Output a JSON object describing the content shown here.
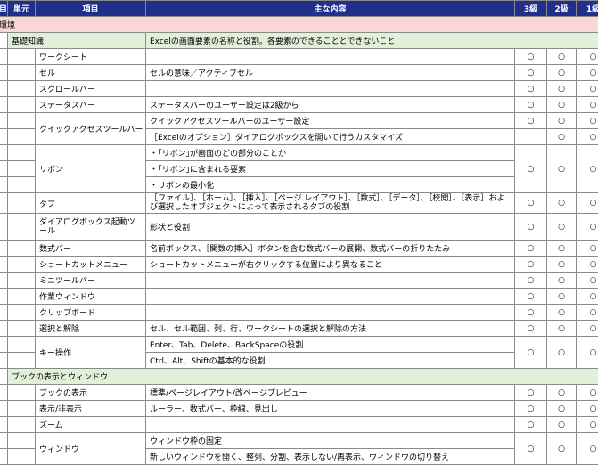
{
  "header": {
    "col0": "目",
    "unit": "単元",
    "item": "項目",
    "content": "主な内容",
    "g3": "3級",
    "g2": "2級",
    "g1": "1級"
  },
  "section": "環境",
  "groups": [
    {
      "title": "基礎知識",
      "title_content": "Excelの画面要素の名称と役割。各要素のできることとできないこと",
      "rows": [
        {
          "item": "ワークシート",
          "contents": [
            ""
          ],
          "g3": "○",
          "g2": "○",
          "g1": "○"
        },
        {
          "item": "セル",
          "contents": [
            "セルの意味／アクティブセル"
          ],
          "g3": "○",
          "g2": "○",
          "g1": "○"
        },
        {
          "item": "スクロールバー",
          "contents": [
            ""
          ],
          "g3": "○",
          "g2": "○",
          "g1": "○"
        },
        {
          "item": "ステータスバー",
          "contents": [
            "ステータスバーのユーザー設定は2級から"
          ],
          "g3": "○",
          "g2": "○",
          "g1": "○"
        },
        {
          "item": "クイックアクセスツールバー",
          "contents": [
            "クイックアクセスツールバーのユーザー設定"
          ],
          "g3": "○",
          "g2": "○",
          "g1": "○"
        },
        {
          "item": "",
          "contents": [
            "［Excelのオプション］ダイアログボックスを開いて行うカスタマイズ"
          ],
          "g3": "",
          "g2": "○",
          "g1": "○"
        },
        {
          "item": "リボン",
          "contents": [
            "・｢リボン｣が画面のどの部分のことか",
            "・｢リボン｣に含まれる要素",
            "・リボンの最小化"
          ],
          "g3": "○",
          "g2": "○",
          "g1": "○"
        },
        {
          "item": "タブ",
          "contents": [
            "［ファイル］、［ホーム］、［挿入］、［ページ レイアウト］、［数式］、［データ］、［校閲］、［表示］および選択したオブジェクトによって表示されるタブの役割"
          ],
          "g3": "○",
          "g2": "○",
          "g1": "○"
        },
        {
          "item": "ダイアログボックス起動ツール",
          "contents": [
            "形状と役割"
          ],
          "g3": "○",
          "g2": "○",
          "g1": "○"
        },
        {
          "item": "数式バー",
          "contents": [
            "名前ボックス、［関数の挿入］ボタンを含む数式バーの展開、数式バーの折りたたみ"
          ],
          "g3": "○",
          "g2": "○",
          "g1": "○"
        },
        {
          "item": "ショートカットメニュー",
          "contents": [
            "ショートカットメニューが右クリックする位置により異なること"
          ],
          "g3": "○",
          "g2": "○",
          "g1": "○"
        },
        {
          "item": "ミニツールバー",
          "contents": [
            ""
          ],
          "g3": "○",
          "g2": "○",
          "g1": "○"
        },
        {
          "item": "作業ウィンドウ",
          "contents": [
            ""
          ],
          "g3": "○",
          "g2": "○",
          "g1": "○"
        },
        {
          "item": "クリップボード",
          "contents": [
            ""
          ],
          "g3": "○",
          "g2": "○",
          "g1": "○"
        },
        {
          "item": "選択と解除",
          "contents": [
            "セル、セル範囲、列、行、ワークシートの選択と解除の方法"
          ],
          "g3": "○",
          "g2": "○",
          "g1": "○"
        },
        {
          "item": "キー操作",
          "contents": [
            "Enter、Tab、Delete、BackSpaceの役割",
            "Ctrl、Alt、Shiftの基本的な役割"
          ],
          "g3": "○",
          "g2": "○",
          "g1": "○"
        }
      ]
    },
    {
      "title": "ブックの表示とウィンドウ",
      "rows": [
        {
          "item": "ブックの表示",
          "contents": [
            "標準/ページレイアウト/改ページプレビュー"
          ],
          "g3": "○",
          "g2": "○",
          "g1": "○"
        },
        {
          "item": "表示/非表示",
          "contents": [
            "ルーラー、数式バー、枠線、見出し"
          ],
          "g3": "○",
          "g2": "○",
          "g1": "○"
        },
        {
          "item": "ズーム",
          "contents": [
            ""
          ],
          "g3": "○",
          "g2": "○",
          "g1": "○"
        },
        {
          "item": "ウィンドウ",
          "contents": [
            "ウィンドウ枠の固定",
            "新しいウィンドウを開く、整列、分割、表示しない/再表示、ウィンドウの切り替え"
          ],
          "g3": "○",
          "g2": "○",
          "g1": "○"
        }
      ]
    }
  ]
}
